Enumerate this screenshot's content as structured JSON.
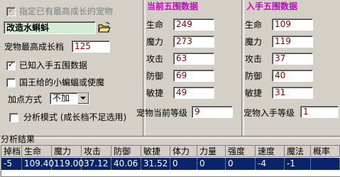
{
  "options": {
    "specify_pet_label": "指定已有最高成长的宠物",
    "pet_name": "改造水蝌蚪",
    "max_growth_label": "宠物最高成长档",
    "max_growth_value": "125",
    "known_stats_label": "已知入手五围数据",
    "king_gift_label": "国王给的小蝙蝠或使魔",
    "add_method_label": "加点方式",
    "add_method_value": "不加",
    "analysis_mode_label": "分析模式 (成长档不足选用)"
  },
  "current": {
    "title": "当前五围数据",
    "stats": [
      {
        "label": "生命",
        "value": "249"
      },
      {
        "label": "魔力",
        "value": "273"
      },
      {
        "label": "攻击",
        "value": "63"
      },
      {
        "label": "防御",
        "value": "69"
      },
      {
        "label": "敏捷",
        "value": "49"
      }
    ],
    "level_label": "宠物当前等级",
    "level_value": "9"
  },
  "initial": {
    "title": "入手五围数据",
    "stats": [
      {
        "label": "生命",
        "value": "109"
      },
      {
        "label": "魔力",
        "value": "119"
      },
      {
        "label": "攻击",
        "value": "37"
      },
      {
        "label": "防御",
        "value": "40"
      },
      {
        "label": "敏捷",
        "value": "31"
      }
    ],
    "level_label": "宠物入手等级",
    "level_value": "1"
  },
  "results": {
    "title": "分析结果",
    "columns": [
      "掉档",
      "生命",
      "魔力",
      "攻击",
      "防御",
      "敏捷",
      "体力",
      "力量",
      "强度",
      "速度",
      "魔法",
      "概率"
    ],
    "rows": [
      [
        "-5",
        "109.40",
        "119.00",
        "37.12",
        "40.06",
        "31.52",
        "0",
        "0",
        "0",
        "-4",
        "-1",
        ""
      ]
    ]
  },
  "colors": {
    "group_title": "#cc00cc",
    "field_text": "#8b0000",
    "selection": "#0a246a"
  }
}
